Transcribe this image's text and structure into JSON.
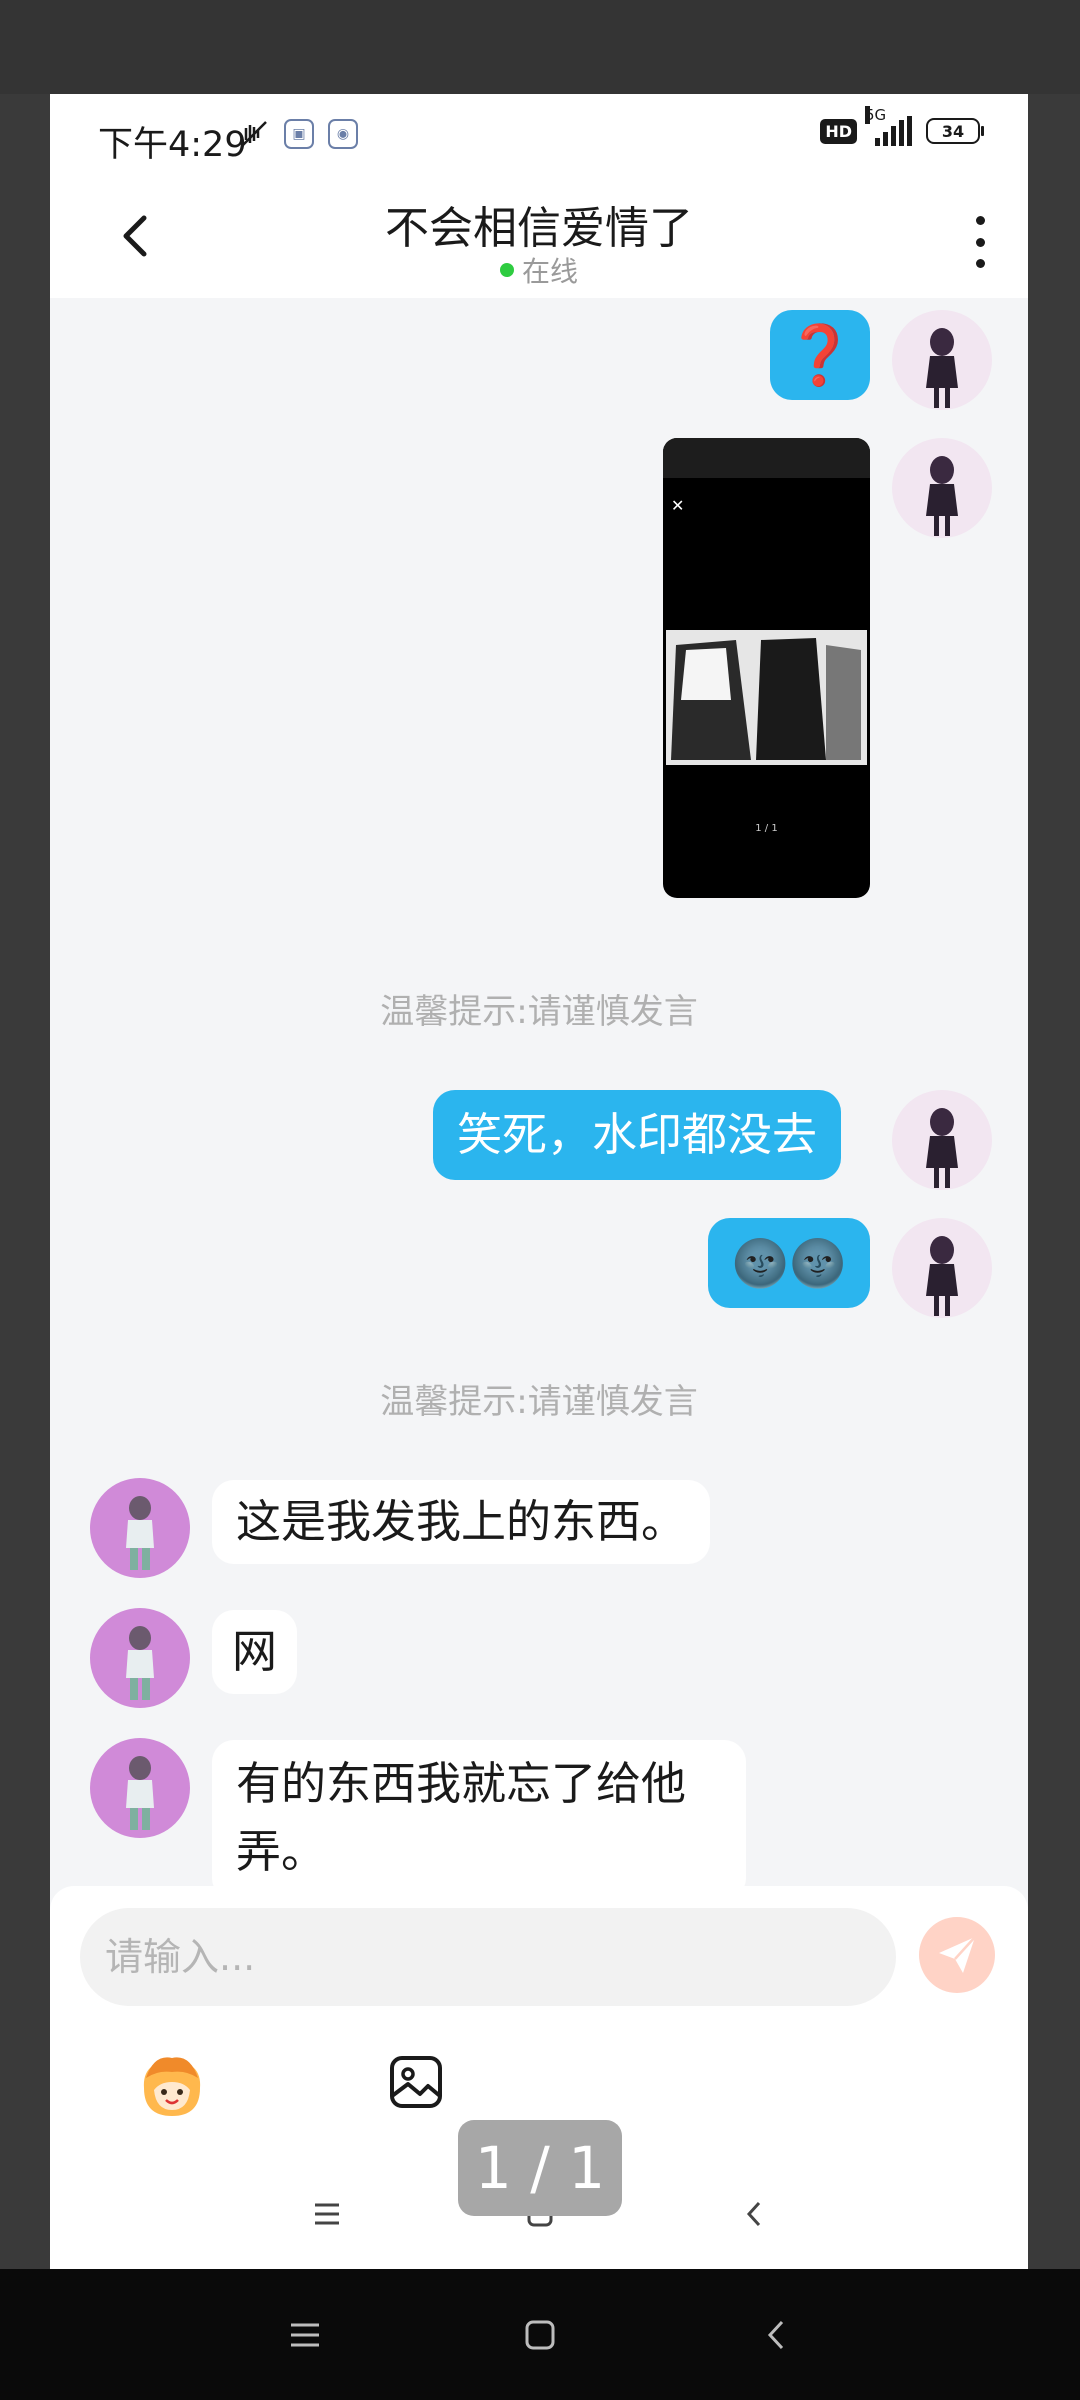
{
  "status_bar": {
    "time": "下午4:29",
    "network": "5G",
    "hd": "HD",
    "battery": "34"
  },
  "header": {
    "title": "不会相信爱情了",
    "presence": "在线"
  },
  "messages": {
    "out_question": "❓",
    "image_page_indicator": "1 / 1",
    "tip_1": "温馨提示:请谨慎发言",
    "out_text": "笑死，水印都没去",
    "out_emoji": "🌚🌚",
    "tip_2": "温馨提示:请谨慎发言",
    "in_1": "这是我发我上的东西。",
    "in_2": "网",
    "in_3": "有的东西我就忘了给他弄。"
  },
  "input": {
    "placeholder": "请输入..."
  },
  "pager": {
    "label": "1 / 1"
  },
  "icons": {
    "back": "chevron-left-icon",
    "more": "more-vertical-icon",
    "send": "send-icon",
    "emoji": "emoji-face-icon",
    "image": "image-icon",
    "menu": "menu-icon",
    "home": "home-icon",
    "nav_back": "back-icon"
  },
  "colors": {
    "outgoing_bubble": "#2bb5ee",
    "incoming_bubble": "#ffffff",
    "online_dot": "#2ecc40",
    "send_button": "#ffd3c6"
  }
}
